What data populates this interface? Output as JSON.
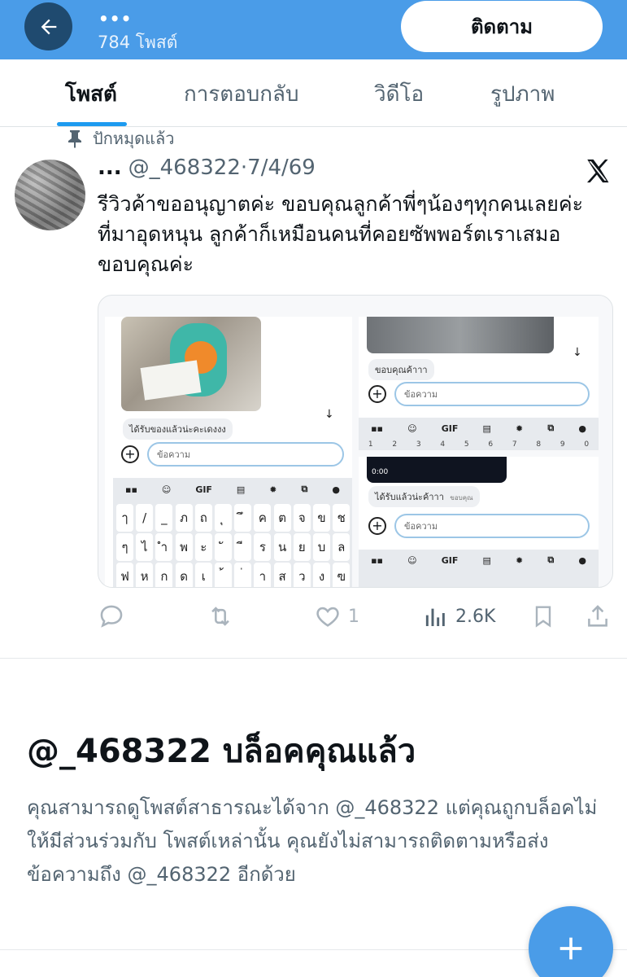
{
  "header": {
    "back_icon": "arrow-left-icon",
    "name": "•••",
    "post_count": "784 โพสต์",
    "follow_label": "ติดตาม",
    "bar_color": "#4a9ce8"
  },
  "tabs": [
    {
      "label": "โพสต์",
      "active": true
    },
    {
      "label": "การตอบกลับ",
      "active": false
    },
    {
      "label": "วิดีโอ",
      "active": false
    },
    {
      "label": "รูปภาพ",
      "active": false
    }
  ],
  "pinned": {
    "icon": "pin-icon",
    "label": "ปักหมุดแล้ว"
  },
  "post": {
    "display_name": "...",
    "handle_date": "@_468322·7/4/69",
    "text": "รีวิวค้าขออนุญาตค่ะ ขอบคุณลูกค้าพี่ๆน้องๆทุกคนเลยค่ะที่มาอุดหนุน ลูกค้าก็เหมือนคนที่คอยซัพพอร์ตเราเสมอขอบคุณค่ะ",
    "source_icon": "x-logo-icon",
    "media": {
      "shot1": {
        "bubble": "ได้รับของแล้วน่ะคะเดงงง",
        "input_placeholder": "ข้อความ",
        "toolbar": [
          "GIF"
        ],
        "key_rows": [
          [
            "ๅ",
            "/",
            "_",
            "ภ",
            "ถ",
            "ุ",
            "ึ",
            "ค",
            "ต",
            "จ",
            "ข",
            "ช"
          ],
          [
            "ๆ",
            "ไ",
            "ำ",
            "พ",
            "ะ",
            "ั",
            "ี",
            "ร",
            "น",
            "ย",
            "บ",
            "ล"
          ],
          [
            "ฟ",
            "ห",
            "ก",
            "ด",
            "เ",
            "้",
            "่",
            "า",
            "ส",
            "ว",
            "ง",
            "ฃ"
          ]
        ]
      },
      "shot2": {
        "bubble": "ขอบคุณค้าาา",
        "input_placeholder": "ข้อความ",
        "toolbar": [
          "GIF"
        ]
      },
      "shot3": {
        "video_time": "0:00",
        "bubble": "ได้รับแล้วน่ะค้าาา",
        "bubble_note": "ขอบคุณ",
        "input_placeholder": "ข้อความ",
        "toolbar": [
          "GIF"
        ]
      }
    },
    "actions": {
      "reply": {
        "icon": "reply-icon",
        "count": ""
      },
      "repost": {
        "icon": "repost-icon",
        "count": ""
      },
      "like": {
        "icon": "heart-icon",
        "count": "1"
      },
      "views": {
        "icon": "views-icon",
        "count": "2.6K"
      },
      "bookmark": {
        "icon": "bookmark-icon"
      },
      "share": {
        "icon": "share-icon"
      }
    }
  },
  "blocked": {
    "title": "@_468322 บล็อคคุณแล้ว",
    "description": "คุณสามารถดูโพสต์สาธารณะได้จาก @_468322 แต่คุณถูกบล็อคไม่ให้มีส่วนร่วมกับ โพสต์เหล่านั้น คุณยังไม่สามารถติดตามหรือส่งข้อความถึง @_468322 อีกด้วย"
  },
  "fab": {
    "icon": "plus-icon"
  }
}
